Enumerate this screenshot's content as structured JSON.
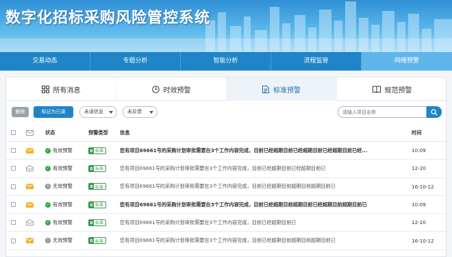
{
  "header": {
    "title": "数字化招标采购风险管控系统"
  },
  "nav": {
    "items": [
      "交易动态",
      "专题分析",
      "智能分析",
      "流程监管",
      "网络预警"
    ],
    "active_index": 4
  },
  "subtabs": {
    "items": [
      {
        "label": "所有消息",
        "icon": "grid-icon"
      },
      {
        "label": "时效预警",
        "icon": "clock-icon"
      },
      {
        "label": "标准预警",
        "icon": "document-icon"
      },
      {
        "label": "规范预警",
        "icon": "book-icon"
      }
    ],
    "active_index": 2
  },
  "toolbar": {
    "delete_label": "删除",
    "mark_read_label": "标记为已读",
    "filter1_value": "未读信息",
    "filter2_value": "未反馈",
    "search_placeholder": "请输入项目名称"
  },
  "table": {
    "headers": {
      "status": "状态",
      "type": "预警类型",
      "info": "信息",
      "time": "时间"
    },
    "rows": [
      {
        "mail": "unread",
        "status": "有效预警",
        "status_color": "green",
        "type": "标准",
        "info": "您有项目69661号的采购计划审批需要在3个工作内容完成，目前已经超期目前已经超期目前已经超期目前已经...",
        "bold": true,
        "time": "10:09"
      },
      {
        "mail": "read",
        "status": "有效预警",
        "status_color": "green",
        "type": "标准",
        "info": "您有项目69661号的采购计划审批需要在3个工作内容完成，目前已经超期目前已经超期目前已",
        "bold": false,
        "time": "12-20"
      },
      {
        "mail": "unread",
        "status": "无效预警",
        "status_color": "gray",
        "type": "标准",
        "info": "您有项目69661号的采购计划审批需要在3个工作内容完成，目前已经超期目前超期目前超期目前已",
        "bold": false,
        "time": "16-10-12"
      },
      {
        "mail": "unread",
        "status": "有效预警",
        "status_color": "green",
        "type": "标准",
        "info": "您有项目69661号的采购计划审批需要在3个工作内容完成，目前已经超期目前超期目前已经超期目前超期目前已",
        "bold": true,
        "time": "10:09"
      },
      {
        "mail": "read",
        "status": "有效预警",
        "status_color": "green",
        "type": "标准",
        "info": "您有项目69661号的采购计划审批需要在3个工作内容完成，目前已经超期目前已",
        "bold": false,
        "time": "12-20"
      },
      {
        "mail": "unread",
        "status": "无效预警",
        "status_color": "gray",
        "type": "标准",
        "info": "您有项目69661号的采购计划审批需要在3个工作内容完成，目前已经超期目前超期目前超期目前已",
        "bold": false,
        "time": "16-10-12"
      }
    ]
  },
  "colors": {
    "accent": "#1f84c8",
    "green": "#2ea84a",
    "gray": "#8a8f95",
    "mail_unread": "#f0b429",
    "mail_read": "#9aa3ad"
  }
}
